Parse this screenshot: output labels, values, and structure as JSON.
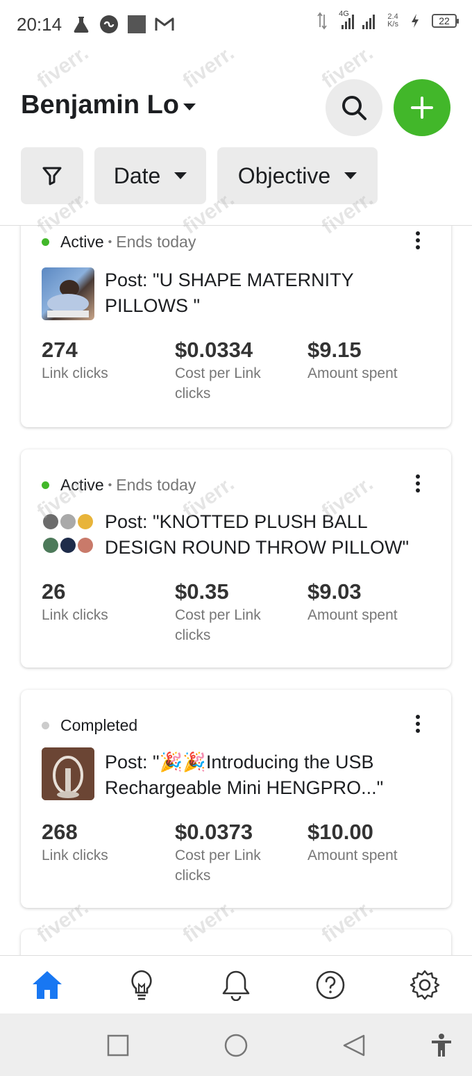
{
  "status_bar": {
    "time": "20:14",
    "network": "4G",
    "speed_value": "2.4",
    "speed_unit": "K/s",
    "battery": "22"
  },
  "header": {
    "account_name": "Benjamin Lo"
  },
  "filters": {
    "date_label": "Date",
    "objective_label": "Objective"
  },
  "ads": [
    {
      "status": "Active",
      "status_extra": "Ends today",
      "status_color": "#42b72a",
      "title": "Post: \"U SHAPE MATERNITY PILLOWS \"",
      "metrics": [
        {
          "value": "274",
          "label": "Link clicks"
        },
        {
          "value": "$0.0334",
          "label": "Cost per Link clicks"
        },
        {
          "value": "$9.15",
          "label": "Amount spent"
        }
      ]
    },
    {
      "status": "Active",
      "status_extra": "Ends today",
      "status_color": "#42b72a",
      "title": "Post: \"KNOTTED PLUSH BALL DESIGN ROUND THROW PILLOW\"",
      "metrics": [
        {
          "value": "26",
          "label": "Link clicks"
        },
        {
          "value": "$0.35",
          "label": "Cost per Link clicks"
        },
        {
          "value": "$9.03",
          "label": "Amount spent"
        }
      ]
    },
    {
      "status": "Completed",
      "status_extra": "",
      "status_color": "#cccccc",
      "title": "Post: \"🎉🎉Introducing the USB Rechargeable Mini HENGPRO...\"",
      "metrics": [
        {
          "value": "268",
          "label": "Link clicks"
        },
        {
          "value": "$0.0373",
          "label": "Cost per Link clicks"
        },
        {
          "value": "$10.00",
          "label": "Amount spent"
        }
      ]
    }
  ],
  "bottom_nav": {
    "items": [
      "home-icon",
      "lightbulb-icon",
      "bell-icon",
      "help-icon",
      "settings-icon"
    ],
    "active_color": "#1877f2"
  },
  "watermark_text": "fiverr."
}
